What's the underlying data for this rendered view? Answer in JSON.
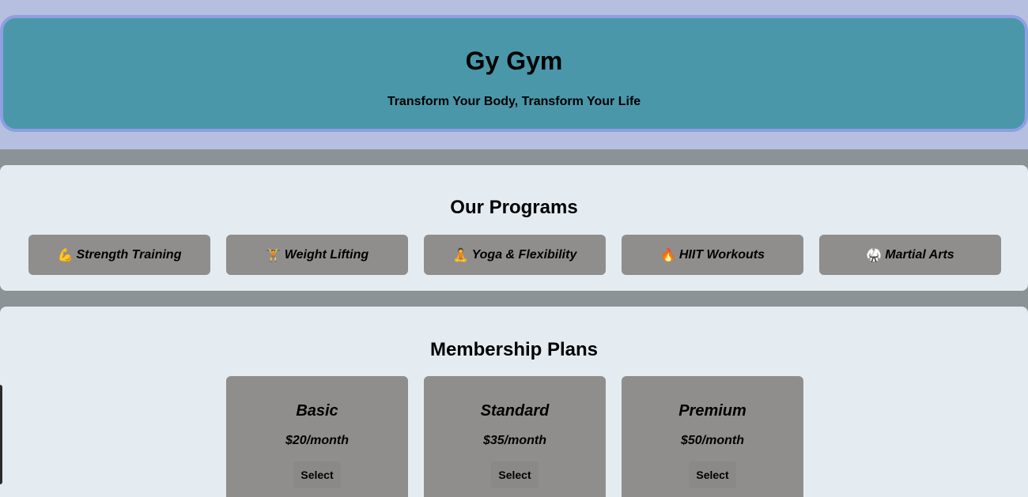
{
  "header": {
    "title": "Gy Gym",
    "tagline": "Transform Your Body, Transform Your Life"
  },
  "programs": {
    "heading": "Our Programs",
    "items": [
      {
        "icon": "💪",
        "icon_name": "flexed-bicep-icon",
        "label": "Strength Training"
      },
      {
        "icon": "🏋",
        "icon_name": "weight-lifter-icon",
        "label": "Weight Lifting"
      },
      {
        "icon": "🧘",
        "icon_name": "yoga-icon",
        "label": "Yoga & Flexibility"
      },
      {
        "icon": "🔥",
        "icon_name": "fire-icon",
        "label": "HIIT Workouts"
      },
      {
        "icon": "🥋",
        "icon_name": "martial-arts-uniform-icon",
        "label": "Martial Arts"
      }
    ]
  },
  "plans": {
    "heading": "Membership Plans",
    "items": [
      {
        "name": "Basic",
        "price": "$20/month",
        "button": "Select"
      },
      {
        "name": "Standard",
        "price": "$35/month",
        "button": "Select"
      },
      {
        "name": "Premium",
        "price": "$50/month",
        "button": "Select"
      }
    ]
  },
  "colors": {
    "header_bg": "#4b97aa",
    "header_border": "#8f9fe0",
    "section_bg": "#e4ecf2",
    "card_bg": "#908e8c",
    "page_bg": "#8b9396"
  }
}
